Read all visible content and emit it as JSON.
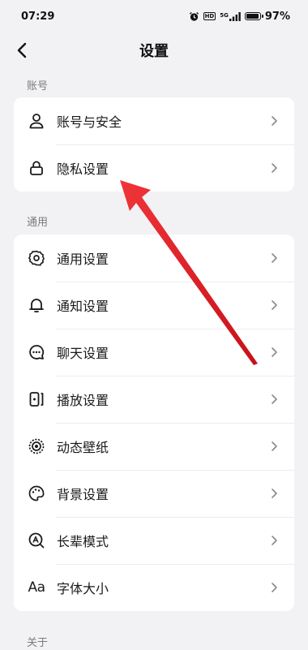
{
  "status_bar": {
    "time": "07:29",
    "network": "5G",
    "hd": "HD",
    "battery_percent": "97%",
    "battery_level": 0.97
  },
  "nav": {
    "title": "设置"
  },
  "sections": {
    "account": {
      "label": "账号",
      "items": [
        {
          "label": "账号与安全",
          "icon": "person-icon"
        },
        {
          "label": "隐私设置",
          "icon": "lock-icon"
        }
      ]
    },
    "general": {
      "label": "通用",
      "items": [
        {
          "label": "通用设置",
          "icon": "gear-icon"
        },
        {
          "label": "通知设置",
          "icon": "bell-icon"
        },
        {
          "label": "聊天设置",
          "icon": "chat-bubble-icon"
        },
        {
          "label": "播放设置",
          "icon": "play-settings-icon"
        },
        {
          "label": "动态壁纸",
          "icon": "live-wallpaper-icon"
        },
        {
          "label": "背景设置",
          "icon": "palette-icon"
        },
        {
          "label": "长辈模式",
          "icon": "elder-mode-icon"
        },
        {
          "label": "字体大小",
          "icon": "font-size-icon",
          "glyph": "Aa"
        }
      ]
    },
    "about": {
      "label": "关于"
    }
  },
  "colors": {
    "background": "#f2f2f4",
    "card": "#ffffff",
    "annotation_arrow": "#e8232a"
  }
}
